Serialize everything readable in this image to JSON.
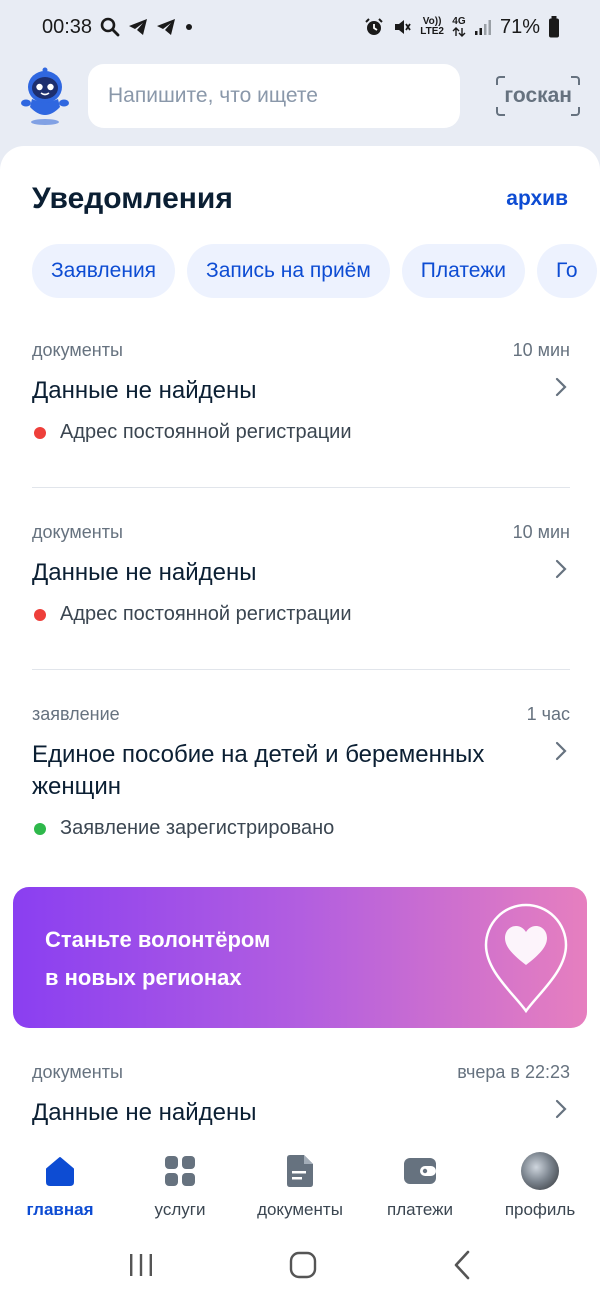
{
  "status_bar": {
    "time": "00:38",
    "battery": "71%",
    "volte_top": "Vo))",
    "volte_bottom": "LTE2",
    "network": "4G"
  },
  "header": {
    "search_placeholder": "Напишите, что ищете",
    "goscan_label": "госкан"
  },
  "notifications": {
    "title": "Уведомления",
    "archive_label": "архив",
    "chips": [
      "Заявления",
      "Запись на приём",
      "Платежи",
      "Го"
    ],
    "items": [
      {
        "category": "документы",
        "time": "10 мин",
        "title": "Данные не найдены",
        "status": "Адрес постоянной регистрации",
        "status_color": "#ee3f3a"
      },
      {
        "category": "документы",
        "time": "10 мин",
        "title": "Данные не найдены",
        "status": "Адрес постоянной регистрации",
        "status_color": "#ee3f3a"
      },
      {
        "category": "заявление",
        "time": "1 час",
        "title": "Единое пособие на детей и беременных женщин",
        "status": "Заявление зарегистрировано",
        "status_color": "#2eb84b"
      },
      {
        "category": "документы",
        "time": "вчера в 22:23",
        "title": "Данные не найдены"
      }
    ]
  },
  "promo": {
    "line1": "Станьте волонтёром",
    "line2": "в новых регионах"
  },
  "bottom_nav": {
    "items": [
      {
        "label": "главная",
        "icon": "home-icon",
        "active": true
      },
      {
        "label": "услуги",
        "icon": "grid-icon"
      },
      {
        "label": "документы",
        "icon": "document-icon"
      },
      {
        "label": "платежи",
        "icon": "wallet-icon"
      },
      {
        "label": "профиль",
        "icon": "avatar"
      }
    ]
  },
  "colors": {
    "accent": "#0d4cd3",
    "chip_bg": "#edf2fe",
    "page_bg": "#e8ecf4"
  }
}
